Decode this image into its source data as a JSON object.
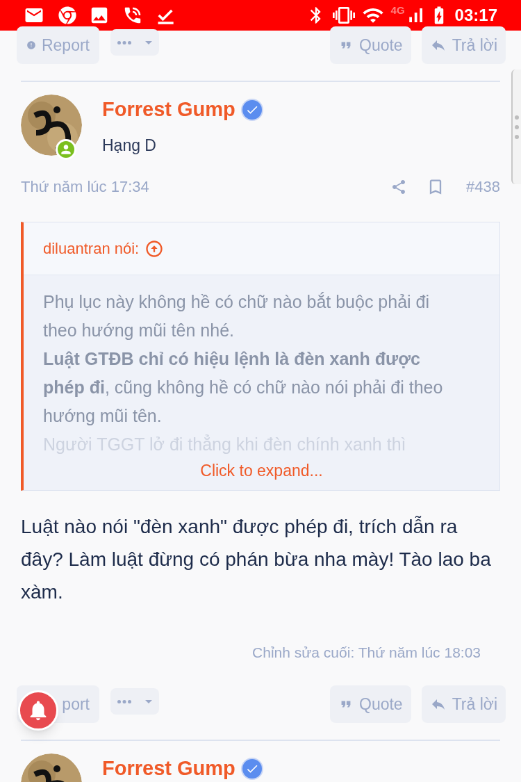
{
  "status_bar": {
    "network": "4G",
    "time": "03:17"
  },
  "top_actions": [
    {
      "kind": "report",
      "label": "Report"
    },
    {
      "kind": "more"
    },
    {
      "kind": "quote",
      "label": "Quote"
    },
    {
      "kind": "reply",
      "label": "Trả lời"
    }
  ],
  "post": {
    "author": "Forrest Gump",
    "verified": true,
    "online": true,
    "rank": "Hạng D",
    "date": "Thứ năm lúc 17:34",
    "number": "#438",
    "quote": {
      "author": "diluantran nói:",
      "paragraphs": [
        "Phụ lục này không hề có chữ nào bắt buộc phải đi theo hướng mũi tên nhé.",
        "**Luật GTĐB chỉ có hiệu lệnh là đèn xanh được phép đi**, cũng không hề có chữ nào nói phải đi theo hướng mũi tên."
      ],
      "faded_line": "Người TGGT lở đi thẳng khi đèn chính xanh thì",
      "expand": "Click to expand..."
    },
    "body": "Luật nào nói \"đèn xanh\" được phép đi, trích dẫn ra đây? Làm luật đừng có phán bừa nha mày! Tào lao ba xàm.",
    "edited": "Chỉnh sửa cuối: Thứ năm lúc 18:03"
  },
  "bottom_actions": [
    {
      "kind": "report",
      "label": "port"
    },
    {
      "kind": "more"
    },
    {
      "kind": "quote",
      "label": "Quote"
    },
    {
      "kind": "reply",
      "label": "Trả lời"
    }
  ],
  "next_post": {
    "author": "Forrest Gump",
    "verified": true
  }
}
